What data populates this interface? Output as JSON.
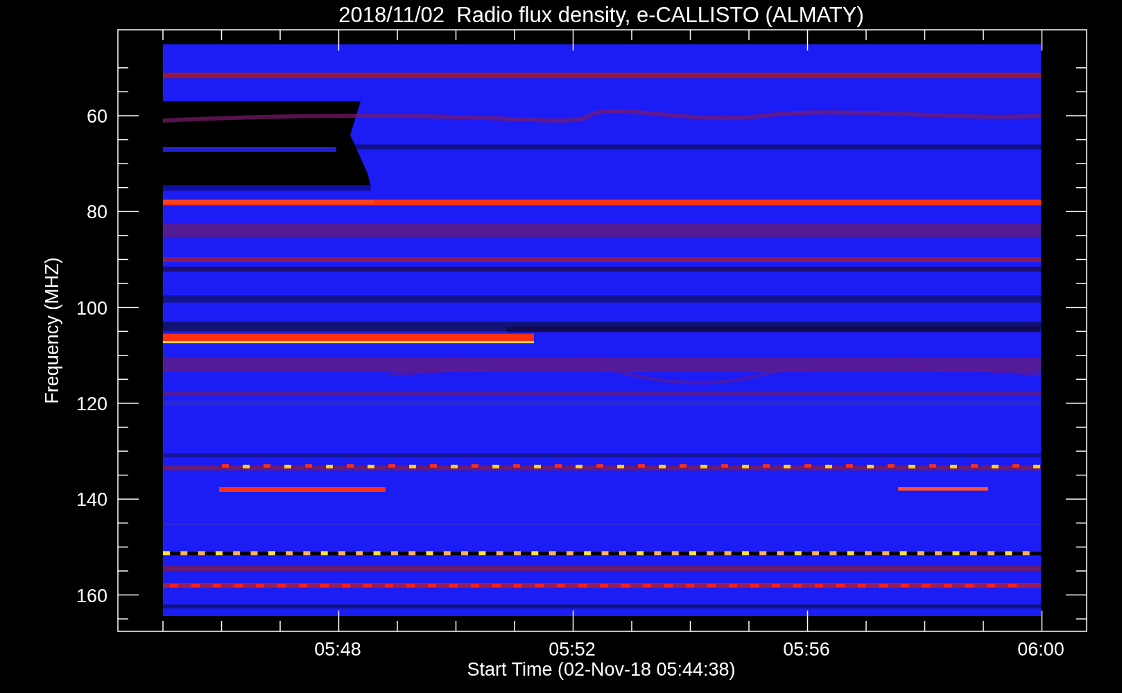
{
  "title": "2018/11/02  Radio flux density, e-CALLISTO (ALMATY)",
  "y_axis": {
    "label": "Frequency (MHZ)",
    "ticks": [
      "60",
      "80",
      "100",
      "120",
      "140",
      "160"
    ]
  },
  "x_axis": {
    "label": "Start Time (02-Nov-18 05:44:38)",
    "ticks": [
      "05:48",
      "05:52",
      "05:56",
      "06:00"
    ]
  }
}
